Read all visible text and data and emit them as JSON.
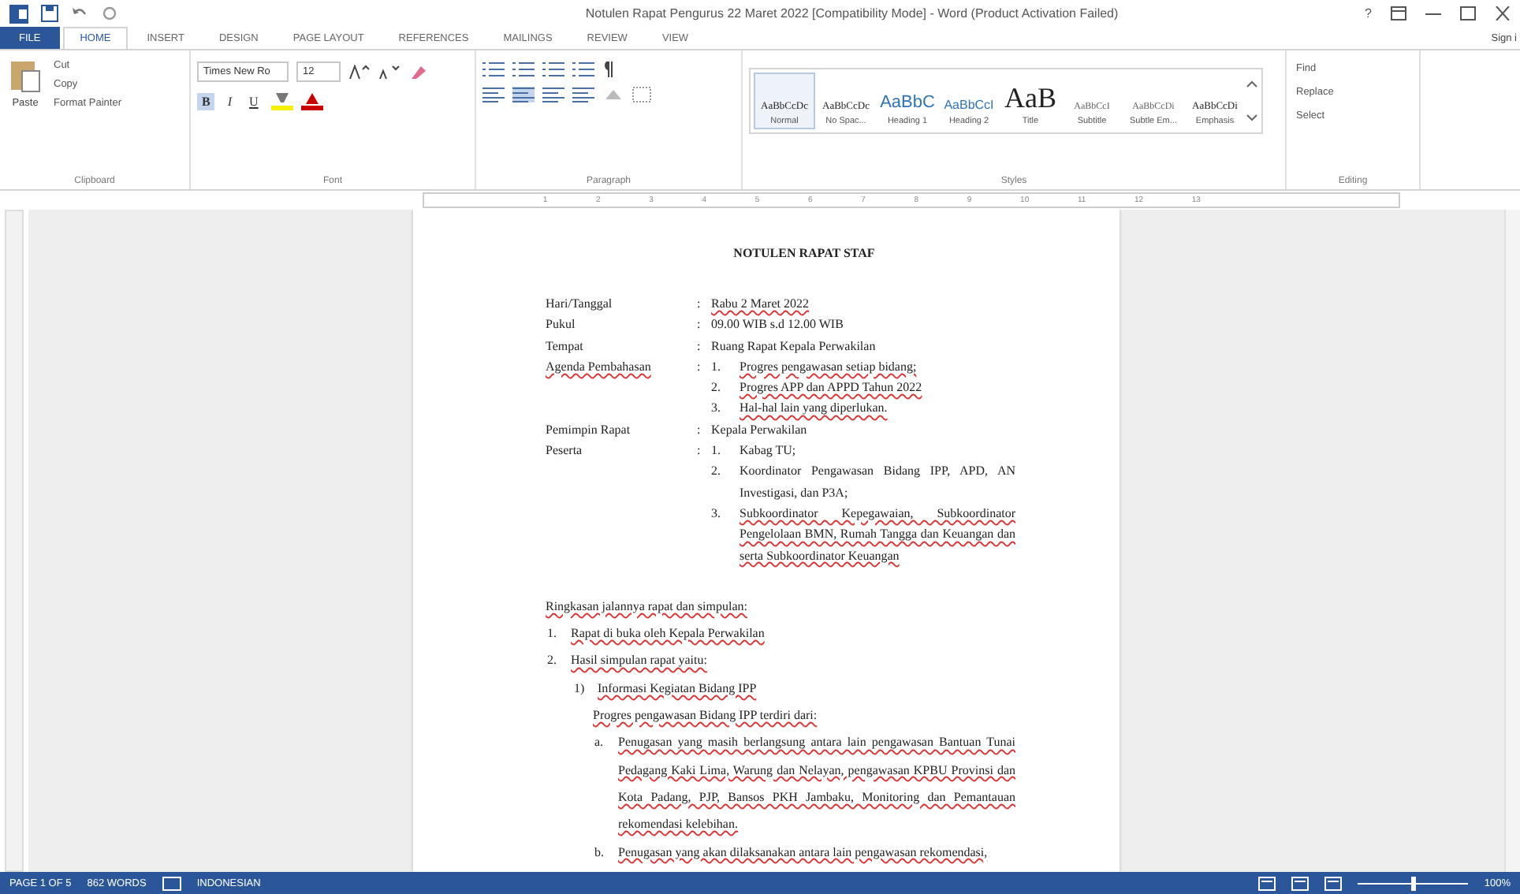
{
  "window": {
    "title": "Notulen Rapat Pengurus 22 Maret 2022 [Compatibility Mode] - Word (Product Activation Failed)",
    "controls": [
      "?"
    ]
  },
  "ribbon_tabs": [
    {
      "label": "FILE",
      "kind": "file",
      "selected": false
    },
    {
      "label": "HOME",
      "kind": "tab",
      "selected": true
    },
    {
      "label": "INSERT",
      "kind": "tab",
      "selected": false
    },
    {
      "label": "DESIGN",
      "kind": "tab",
      "selected": false
    },
    {
      "label": "PAGE LAYOUT",
      "kind": "tab",
      "selected": false
    },
    {
      "label": "REFERENCES",
      "kind": "tab",
      "selected": false
    },
    {
      "label": "MAILINGS",
      "kind": "tab",
      "selected": false
    },
    {
      "label": "REVIEW",
      "kind": "tab",
      "selected": false
    },
    {
      "label": "VIEW",
      "kind": "tab",
      "selected": false
    }
  ],
  "account": "Sign i",
  "clipboard": {
    "paste": "Paste",
    "items": [
      "Cut",
      "Copy",
      "Format Painter"
    ],
    "label": "Clipboard"
  },
  "font": {
    "name": "Times New Ro",
    "size": "12",
    "format_buttons": [
      {
        "label": "B",
        "selected": true
      },
      {
        "label": "I",
        "selected": false
      },
      {
        "label": "U",
        "selected": false
      }
    ],
    "label": "Font"
  },
  "paragraph": {
    "label": "Paragraph"
  },
  "styles": {
    "label": "Styles",
    "items": [
      {
        "sample": "AaBbCcDc",
        "name": "Normal",
        "kind": "small",
        "selected": true
      },
      {
        "sample": "AaBbCcDc",
        "name": "No Spac...",
        "kind": "small",
        "selected": false
      },
      {
        "sample": "AaBbC",
        "name": "Heading 1",
        "kind": "heading",
        "selected": false
      },
      {
        "sample": "AaBbCcI",
        "name": "Heading 2",
        "kind": "heading2",
        "selected": false
      },
      {
        "sample": "AaB",
        "name": "Title",
        "kind": "title",
        "selected": false
      },
      {
        "sample": "AaBbCcI",
        "name": "Subtitle",
        "kind": "subtle",
        "selected": false
      },
      {
        "sample": "AaBbCcDi",
        "name": "Subtle Em...",
        "kind": "subtle",
        "selected": false
      },
      {
        "sample": "AaBbCcDi",
        "name": "Emphasis",
        "kind": "small",
        "selected": false
      }
    ]
  },
  "editing": {
    "label": "Editing",
    "items": [
      "Find",
      "Replace",
      "Select"
    ]
  },
  "ruler": [
    "1",
    "2",
    "3",
    "4",
    "5",
    "6",
    "7",
    "8",
    "9",
    "10",
    "11",
    "12",
    "13"
  ],
  "document": {
    "title": "NOTULEN RAPAT STAF",
    "fields": [
      {
        "label": "Hari/Tanggal",
        "colon": ":",
        "flagged": false,
        "values": [
          {
            "text": "Rabu 2 Maret 2022",
            "flagged": true
          }
        ]
      },
      {
        "label": "Pukul",
        "colon": ":",
        "flagged": false,
        "values": [
          {
            "text": "09.00 WIB s.d 12.00 WIB",
            "flagged": false
          }
        ]
      },
      {
        "label": "Tempat",
        "colon": ":",
        "flagged": false,
        "values": [
          {
            "text": "Ruang Rapat Kepala Perwakilan",
            "flagged": false
          }
        ]
      },
      {
        "label": "Agenda Pembahasan",
        "colon": ":",
        "flagged": true,
        "values": [
          {
            "number": "1.",
            "text": "Progres pengawasan setiap bidang;",
            "flagged": true
          },
          {
            "number": "2.",
            "text": "Progres APP dan APPD Tahun 2022",
            "flagged": true
          },
          {
            "number": "3.",
            "text": "Hal-hal lain yang diperlukan.",
            "flagged": true
          }
        ]
      },
      {
        "label": "Pemimpin Rapat",
        "colon": ":",
        "flagged": false,
        "values": [
          {
            "text": "Kepala Perwakilan",
            "flagged": false
          }
        ]
      },
      {
        "label": "Peserta",
        "colon": ":",
        "flagged": false,
        "values": [
          {
            "number": "1.",
            "text": "Kabag TU;",
            "flagged": false
          },
          {
            "number": "2.",
            "text": "Koordinator Pengawasan Bidang IPP, APD, AN Investigasi, dan P3A;",
            "flagged": false
          },
          {
            "number": "3.",
            "text": "Subkoordinator Kepegawaian, Subkoordinator Pengelolaan BMN, Rumah Tangga dan Keuangan dan serta Subkoordinator Keuangan",
            "flagged": true
          }
        ]
      }
    ],
    "summary_heading": "Ringkasan jalannya rapat dan simpulan:",
    "summary": [
      {
        "number": "1.",
        "text": "Rapat di buka oleh Kepala Perwakilan",
        "flagged": true
      },
      {
        "number": "2.",
        "text": "Hasil simpulan rapat yaitu:",
        "flagged": true,
        "children": [
          {
            "number": "1)",
            "text": "Informasi Kegiatan Bidang IPP",
            "flagged": true,
            "intro": "Progres pengawasan Bidang IPP terdiri dari:",
            "children": [
              {
                "number": "a.",
                "text": "Penugasan yang masih berlangsung antara lain pengawasan Bantuan Tunai Pedagang Kaki Lima, Warung dan Nelayan, pengawasan KPBU Provinsi dan Kota Padang, PJP, Bansos PKH Jambaku, Monitoring dan Pemantauan rekomendasi kelebihan.",
                "flagged": true
              },
              {
                "number": "b.",
                "text": "Penugasan yang akan dilaksanakan antara lain pengawasan rekomendasi,",
                "flagged": true
              }
            ]
          }
        ]
      }
    ]
  },
  "status_bar": {
    "page": "PAGE 1 OF 5",
    "words": "862 WORDS",
    "language": "INDONESIAN",
    "zoom": "100%",
    "zoom_slider": {
      "level": 0.5
    }
  }
}
